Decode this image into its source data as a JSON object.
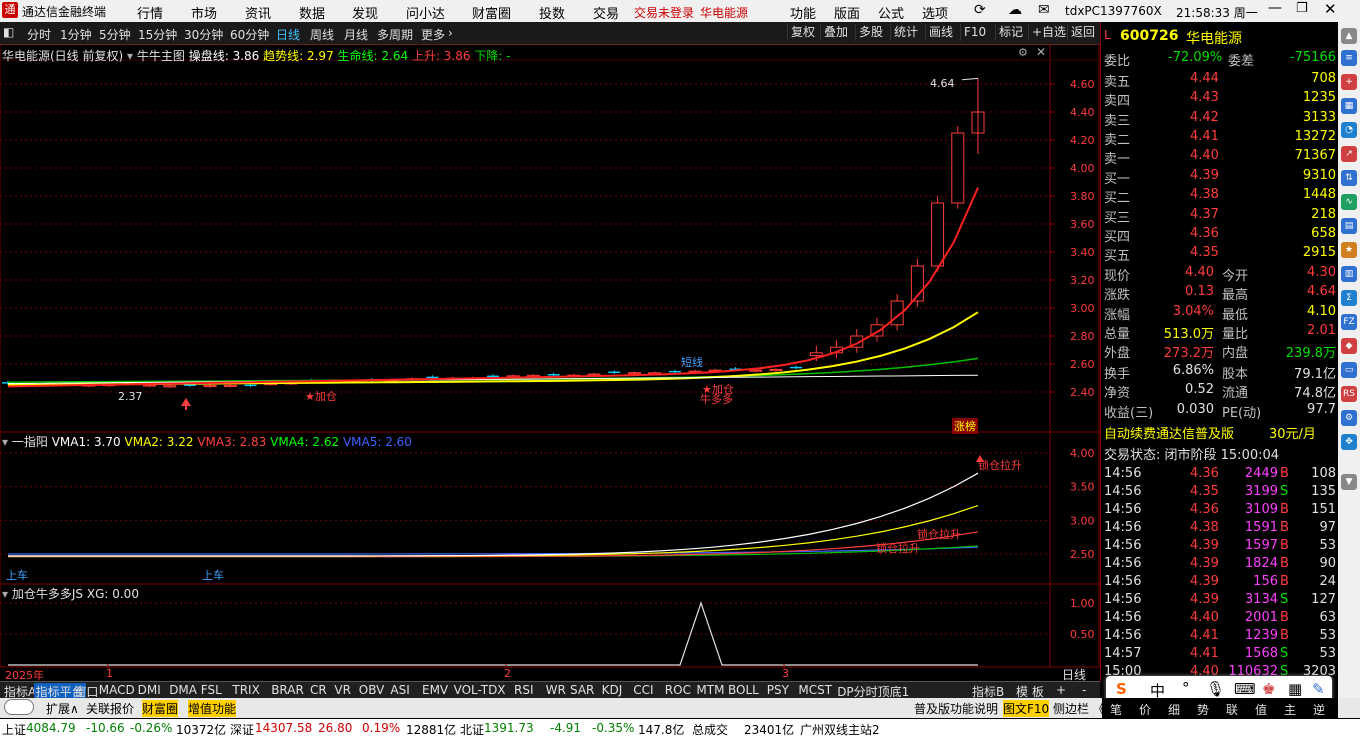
{
  "menubar": {
    "app_title": "通达信金融终端",
    "menus": [
      "行情",
      "市场",
      "资讯",
      "数据",
      "发现",
      "问小达",
      "财富圈",
      "投数",
      "交易"
    ],
    "login_warning": "交易未登录",
    "stock_name_red": "华电能源",
    "right_menus": [
      "功能",
      "版面",
      "公式",
      "选项"
    ],
    "machine_id": "tdxPC1397760X",
    "clock": "21:58:33 周一"
  },
  "toolbar": {
    "periods": [
      "分时",
      "1分钟",
      "5分钟",
      "15分钟",
      "30分钟",
      "60分钟",
      "日线",
      "周线",
      "月线",
      "多周期",
      "更多"
    ],
    "active_period": "日线",
    "buttons": [
      "复权",
      "叠加",
      "多股",
      "统计",
      "画线",
      "F10",
      "标记",
      "+自选",
      "返回"
    ]
  },
  "main_chart": {
    "legend_title": "华电能源(日线 前复权)",
    "indicator_name": "牛牛主图",
    "legend_items": [
      {
        "label": "操盘线: 3.86",
        "color": "#ffffff"
      },
      {
        "label": "趋势线: 2.97",
        "color": "#ffff00"
      },
      {
        "label": "生命线: 2.64",
        "color": "#00ff00"
      },
      {
        "label": "上升: 3.86",
        "color": "#ff3c3c"
      },
      {
        "label": "下降: -",
        "color": "#00e000"
      }
    ],
    "y_ticks": [
      "4.60",
      "4.40",
      "4.20",
      "4.00",
      "3.80",
      "3.60",
      "3.40",
      "3.20",
      "3.00",
      "2.80",
      "2.60",
      "2.40"
    ],
    "high_label": "4.64",
    "low_label": "2.37",
    "annotations": [
      "★加仓",
      "★加仓",
      "牛多多",
      "短线"
    ],
    "badge": "涨榜"
  },
  "sub1": {
    "title": "一指阳",
    "legend_items": [
      {
        "label": "VMA1: 3.70",
        "color": "#ffffff"
      },
      {
        "label": "VMA2: 3.22",
        "color": "#ffff00"
      },
      {
        "label": "VMA3: 2.83",
        "color": "#ff4040"
      },
      {
        "label": "VMA4: 2.62",
        "color": "#00ff00"
      },
      {
        "label": "VMA5: 2.60",
        "color": "#4060ff"
      }
    ],
    "y_ticks": [
      "4.00",
      "3.50",
      "3.00",
      "2.50"
    ],
    "labels": [
      "锁仓拉升",
      "锁仓拉升",
      "锁仓拉升",
      "上车",
      "上车"
    ]
  },
  "sub2": {
    "title": "加仓牛多多JS",
    "legend_items": [
      {
        "label": "XG: 0.00",
        "color": "#e0e0e0"
      }
    ],
    "y_ticks": [
      "1.00",
      "0.50"
    ]
  },
  "time_axis": {
    "labels": [
      "2025年",
      "1",
      "2",
      "3"
    ],
    "right_label": "日线"
  },
  "panel": {
    "code": "600726",
    "name": "华电能源",
    "tag": "L",
    "weibi_label": "委比",
    "weibi": "-72.09%",
    "weicha_label": "委差",
    "weicha": "-75166",
    "asks": [
      {
        "label": "卖五",
        "price": "4.44",
        "vol": "708"
      },
      {
        "label": "卖四",
        "price": "4.43",
        "vol": "1235"
      },
      {
        "label": "卖三",
        "price": "4.42",
        "vol": "3133"
      },
      {
        "label": "卖二",
        "price": "4.41",
        "vol": "13272"
      },
      {
        "label": "卖一",
        "price": "4.40",
        "vol": "71367"
      }
    ],
    "bids": [
      {
        "label": "买一",
        "price": "4.39",
        "vol": "9310"
      },
      {
        "label": "买二",
        "price": "4.38",
        "vol": "1448"
      },
      {
        "label": "买三",
        "price": "4.37",
        "vol": "218"
      },
      {
        "label": "买四",
        "price": "4.36",
        "vol": "658"
      },
      {
        "label": "买五",
        "price": "4.35",
        "vol": "2915"
      }
    ],
    "stats": [
      {
        "l1": "现价",
        "v1": "4.40",
        "c1": "r",
        "l2": "今开",
        "v2": "4.30",
        "c2": "r"
      },
      {
        "l1": "涨跌",
        "v1": "0.13",
        "c1": "r",
        "l2": "最高",
        "v2": "4.64",
        "c2": "r"
      },
      {
        "l1": "涨幅",
        "v1": "3.04%",
        "c1": "r",
        "l2": "最低",
        "v2": "4.10",
        "c2": "y"
      },
      {
        "l1": "总量",
        "v1": "513.0万",
        "c1": "y",
        "l2": "量比",
        "v2": "2.01",
        "c2": "r"
      },
      {
        "l1": "外盘",
        "v1": "273.2万",
        "c1": "r",
        "l2": "内盘",
        "v2": "239.8万",
        "c2": "g"
      }
    ],
    "stats2": [
      {
        "l1": "换手",
        "v1": "6.86%",
        "l2": "股本",
        "v2": "79.1亿"
      },
      {
        "l1": "净资",
        "v1": "0.52",
        "l2": "流通",
        "v2": "74.8亿"
      },
      {
        "l1": "收益(三)",
        "v1": "0.030",
        "l2": "PE(动)",
        "v2": "97.7"
      }
    ],
    "promo": "自动续费通达信普及版",
    "promo_price": "30元/月",
    "trade_status": "交易状态: 闭市阶段 15:00:04",
    "ticks": [
      {
        "t": "14:56",
        "p": "4.36",
        "v": "2449",
        "s": "B",
        "n": "108"
      },
      {
        "t": "14:56",
        "p": "4.35",
        "v": "3199",
        "s": "S",
        "n": "135"
      },
      {
        "t": "14:56",
        "p": "4.36",
        "v": "3109",
        "s": "B",
        "n": "151"
      },
      {
        "t": "14:56",
        "p": "4.38",
        "v": "1591",
        "s": "B",
        "n": "97"
      },
      {
        "t": "14:56",
        "p": "4.39",
        "v": "1597",
        "s": "B",
        "n": "53"
      },
      {
        "t": "14:56",
        "p": "4.39",
        "v": "1824",
        "s": "B",
        "n": "90"
      },
      {
        "t": "14:56",
        "p": "4.39",
        "v": "156",
        "s": "B",
        "n": "24"
      },
      {
        "t": "14:56",
        "p": "4.39",
        "v": "3134",
        "s": "S",
        "n": "127"
      },
      {
        "t": "14:56",
        "p": "4.40",
        "v": "2001",
        "s": "B",
        "n": "63"
      },
      {
        "t": "14:56",
        "p": "4.41",
        "v": "1239",
        "s": "B",
        "n": "53"
      },
      {
        "t": "14:57",
        "p": "4.41",
        "v": "1568",
        "s": "S",
        "n": "53"
      },
      {
        "t": "15:00",
        "p": "4.40",
        "v": "110632",
        "s": "S",
        "n": "3203"
      }
    ]
  },
  "tabs": [
    "指标A",
    "指标平台",
    "窗口",
    "MACD",
    "DMI",
    "DMA",
    "FSL",
    "TRIX",
    "BRAR",
    "CR",
    "VR",
    "OBV",
    "ASI",
    "EMV",
    "VOL-TDX",
    "RSI",
    "WR",
    "SAR",
    "KDJ",
    "CCI",
    "ROC",
    "MTM",
    "BOLL",
    "PSY",
    "MCST",
    "DP分时顶底1"
  ],
  "tabs_right": [
    "指标B",
    "模 板",
    "+",
    "-"
  ],
  "tabs2": {
    "left": [
      "扩展∧",
      "关联报价",
      "财富圈",
      "增值功能"
    ],
    "right": [
      "普及版功能说明",
      "图文F10",
      "侧边栏 《"
    ],
    "bottom_right": [
      "笔",
      "价",
      "细",
      "势",
      "联",
      "值",
      "主",
      "逆"
    ]
  },
  "statusbar": {
    "sh_label": "上证",
    "sh": "4084.79",
    "sh_chg": "-10.66",
    "sh_pct": "-0.26%",
    "sh_amt": "10372亿",
    "sz_label": "深证",
    "sz": "14307.58",
    "sz_chg": "26.80",
    "sz_pct": "0.19%",
    "sz_amt": "12881亿",
    "bz_label": "北证",
    "bz": "1391.73",
    "bz_chg": "-4.91",
    "bz_pct": "-0.35%",
    "bz_amt": "147.8亿",
    "total_label": "总成交",
    "total": "23401亿",
    "server": "广州双线主站2"
  },
  "colors": {
    "up": "#ff3c3c",
    "down": "#00e000",
    "accent": "#40c0ff",
    "bg": "#000000"
  }
}
